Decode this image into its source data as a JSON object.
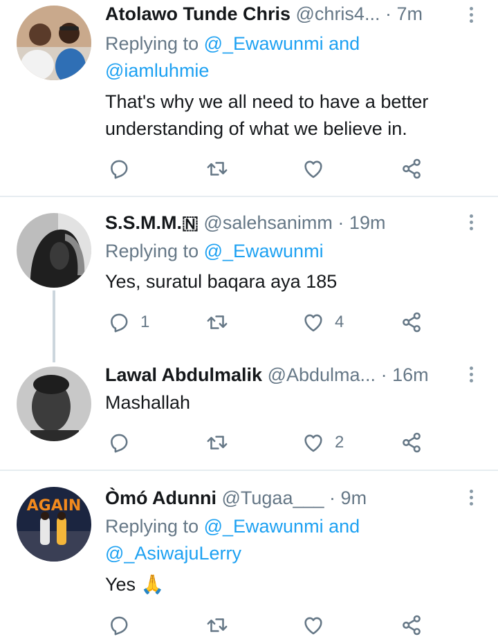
{
  "tweets": [
    {
      "name": "Atolawo Tunde Chris",
      "handle": "@chris4...",
      "dot": "·",
      "time": "7m",
      "reply_prefix": "Replying to ",
      "reply_mentions_line1": "@_Ewawunmi and",
      "reply_mentions_line2": "@iamluhmie",
      "text_line1": "That's why we all need to have a better",
      "text_line2": "understanding of what we believe in.",
      "reply_count": "",
      "like_count": ""
    },
    {
      "name": "S.S.M.M.🇳",
      "handle": "@salehsanimm",
      "dot": "·",
      "time": "19m",
      "reply_prefix": "Replying to ",
      "reply_mentions_line1": "@_Ewawunmi",
      "text_line1": "Yes, suratul baqara aya 185",
      "reply_count": "1",
      "like_count": "4"
    },
    {
      "name": "Lawal Abdulmalik",
      "handle": "@Abdulma...",
      "dot": "·",
      "time": "16m",
      "text_line1": "Mashallah",
      "reply_count": "",
      "like_count": "2"
    },
    {
      "name": "Òmó Adunni",
      "handle": "@Tugaa___",
      "dot": "·",
      "time": "9m",
      "reply_prefix": "Replying to ",
      "reply_mentions_line1": "@_Ewawunmi and",
      "reply_mentions_line2": "@_AsiwajuLerry",
      "text_line1": "Yes 🙏",
      "avatar_text": "AGAIN"
    }
  ],
  "icons": {
    "reply": "reply-icon",
    "retweet": "retweet-icon",
    "like": "heart-icon",
    "share": "share-icon",
    "more": "more-vertical-icon"
  },
  "colors": {
    "accent": "#1da1f2",
    "secondary_text": "#657786",
    "divider": "#e6ecf0"
  }
}
